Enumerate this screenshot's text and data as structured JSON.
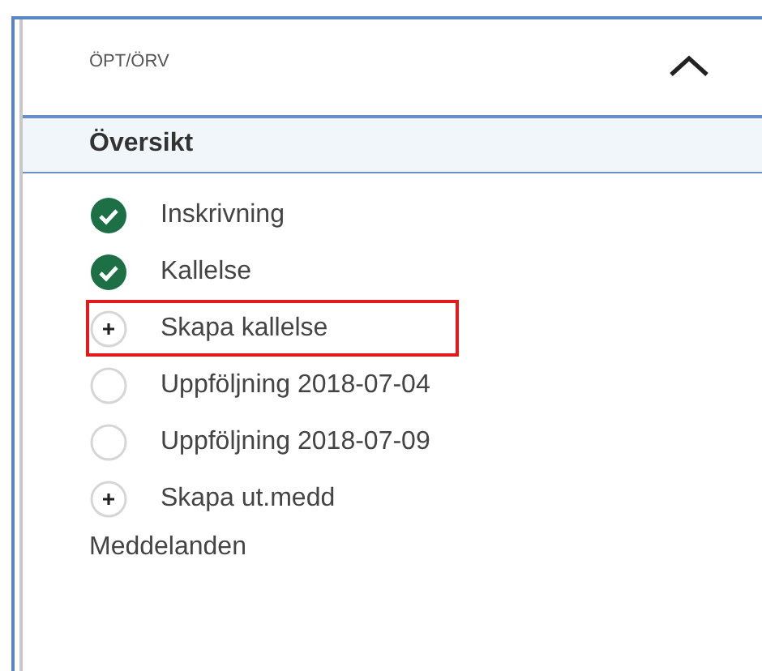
{
  "panel": {
    "title": "ÖPT/ÖRV",
    "expanded": true
  },
  "section": {
    "title": "Översikt"
  },
  "items": [
    {
      "kind": "done",
      "label": "Inskrivning",
      "highlighted": false
    },
    {
      "kind": "done",
      "label": "Kallelse",
      "highlighted": false
    },
    {
      "kind": "add",
      "label": "Skapa kallelse",
      "highlighted": true
    },
    {
      "kind": "pending",
      "label": "Uppföljning 2018-07-04",
      "highlighted": false
    },
    {
      "kind": "pending",
      "label": "Uppföljning 2018-07-09",
      "highlighted": false
    },
    {
      "kind": "add",
      "label": "Skapa ut.medd",
      "highlighted": false
    }
  ],
  "footer_link": "Meddelanden"
}
